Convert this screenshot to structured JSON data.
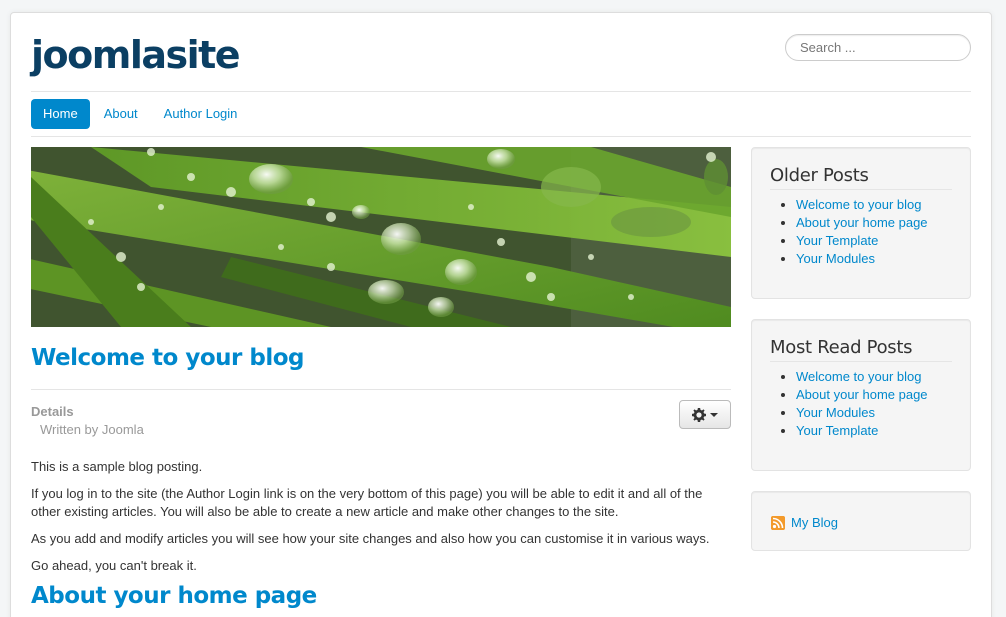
{
  "site": {
    "brand": "joomlasite",
    "search_placeholder": "Search ..."
  },
  "nav": {
    "items": [
      {
        "label": "Home",
        "active": true
      },
      {
        "label": "About",
        "active": false
      },
      {
        "label": "Author Login",
        "active": false
      }
    ]
  },
  "article": {
    "title": "Welcome to your blog",
    "details_label": "Details",
    "written_by": "Written by Joomla",
    "paragraphs": [
      "This is a sample blog posting.",
      "If you log in to the site (the Author Login link is on the very bottom of this page) you will be able to edit it and all of the other existing articles. You will also be able to create a new article and make other changes to the site.",
      "As you add and modify articles you will see how your site changes and also how you can customise it in various ways.",
      "Go ahead, you can't break it."
    ],
    "next_title": "About your home page"
  },
  "sidebar": {
    "older_posts": {
      "title": "Older Posts",
      "items": [
        "Welcome to your blog",
        "About your home page",
        "Your Template",
        "Your Modules"
      ]
    },
    "most_read": {
      "title": "Most Read Posts",
      "items": [
        "Welcome to your blog",
        "About your home page",
        "Your Modules",
        "Your Template"
      ]
    },
    "feed": {
      "label": "My Blog",
      "icon": "rss-feed-icon"
    }
  },
  "colors": {
    "link": "#0088cc",
    "brand": "#0b3f63",
    "well_bg": "#f5f5f5"
  }
}
